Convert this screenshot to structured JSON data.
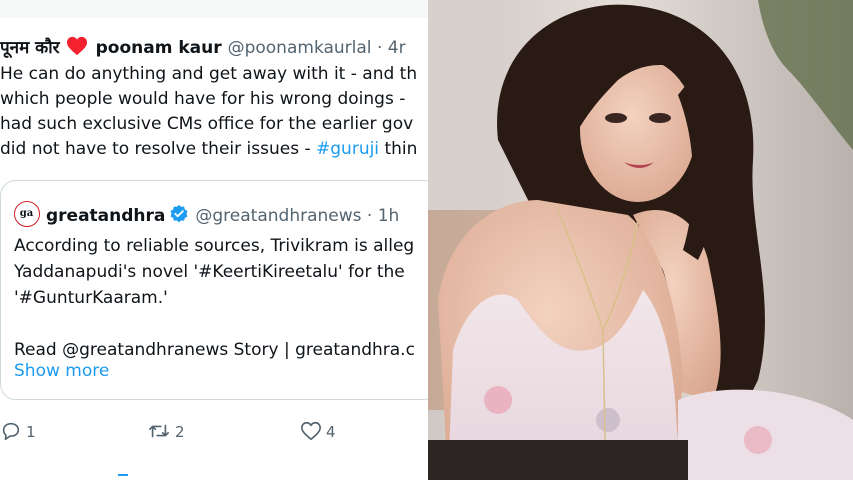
{
  "tweet": {
    "author_hindi": "पूनम कौर",
    "author_name": "poonam kaur",
    "handle": "@poonamkaurlal",
    "dot": "·",
    "time": "4r",
    "lines": [
      "He can do anything and get away with it - and th",
      "which people would have for his wrong doings - ",
      "had such exclusive CMs office for the earlier gov",
      "did not have to resolve their issues - "
    ],
    "hashtag": "#guruji",
    "hashtag_tail": " thin"
  },
  "quote": {
    "avatar_text": "ga",
    "name": "greatandhra",
    "handle": "@greatandhranews",
    "dot": "·",
    "time": "1h",
    "body_lines": [
      "According to reliable sources, Trivikram is alleg",
      "Yaddanapudi's novel '#KeertiKireetalu' for the ",
      "'#GunturKaaram.'"
    ],
    "read_line": "Read @greatandhranews Story | greatandhra.c",
    "show_more": "Show more"
  },
  "actions": {
    "replies": "1",
    "reposts": "2",
    "likes": "4"
  },
  "colors": {
    "link": "#1d9bf0",
    "muted": "#536471",
    "heart": "#f4212e",
    "border": "#cfd9de"
  },
  "icons": [
    "heart-icon",
    "verified-badge-icon",
    "reply-icon",
    "repost-icon",
    "like-icon"
  ]
}
